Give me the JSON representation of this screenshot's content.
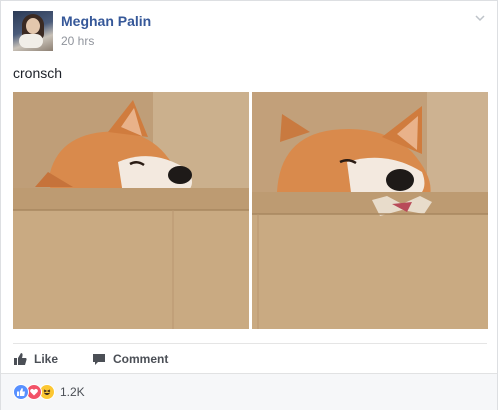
{
  "post": {
    "author": "Meghan Palin",
    "timestamp": "20 hrs",
    "text": "cronsch"
  },
  "actions": {
    "like_label": "Like",
    "comment_label": "Comment"
  },
  "reactions": {
    "count": "1.2K",
    "types": [
      "like-icon",
      "love-icon",
      "haha-icon"
    ]
  },
  "colors": {
    "author_link": "#365899",
    "meta_text": "#90949c",
    "like_blue": "#5890ff",
    "love_red": "#f25268",
    "haha_yellow": "#fcc733"
  },
  "photos": [
    {
      "subject": "shiba-inu-dog-in-cardboard-box"
    },
    {
      "subject": "shiba-inu-dog-chewing-cardboard-box"
    }
  ]
}
